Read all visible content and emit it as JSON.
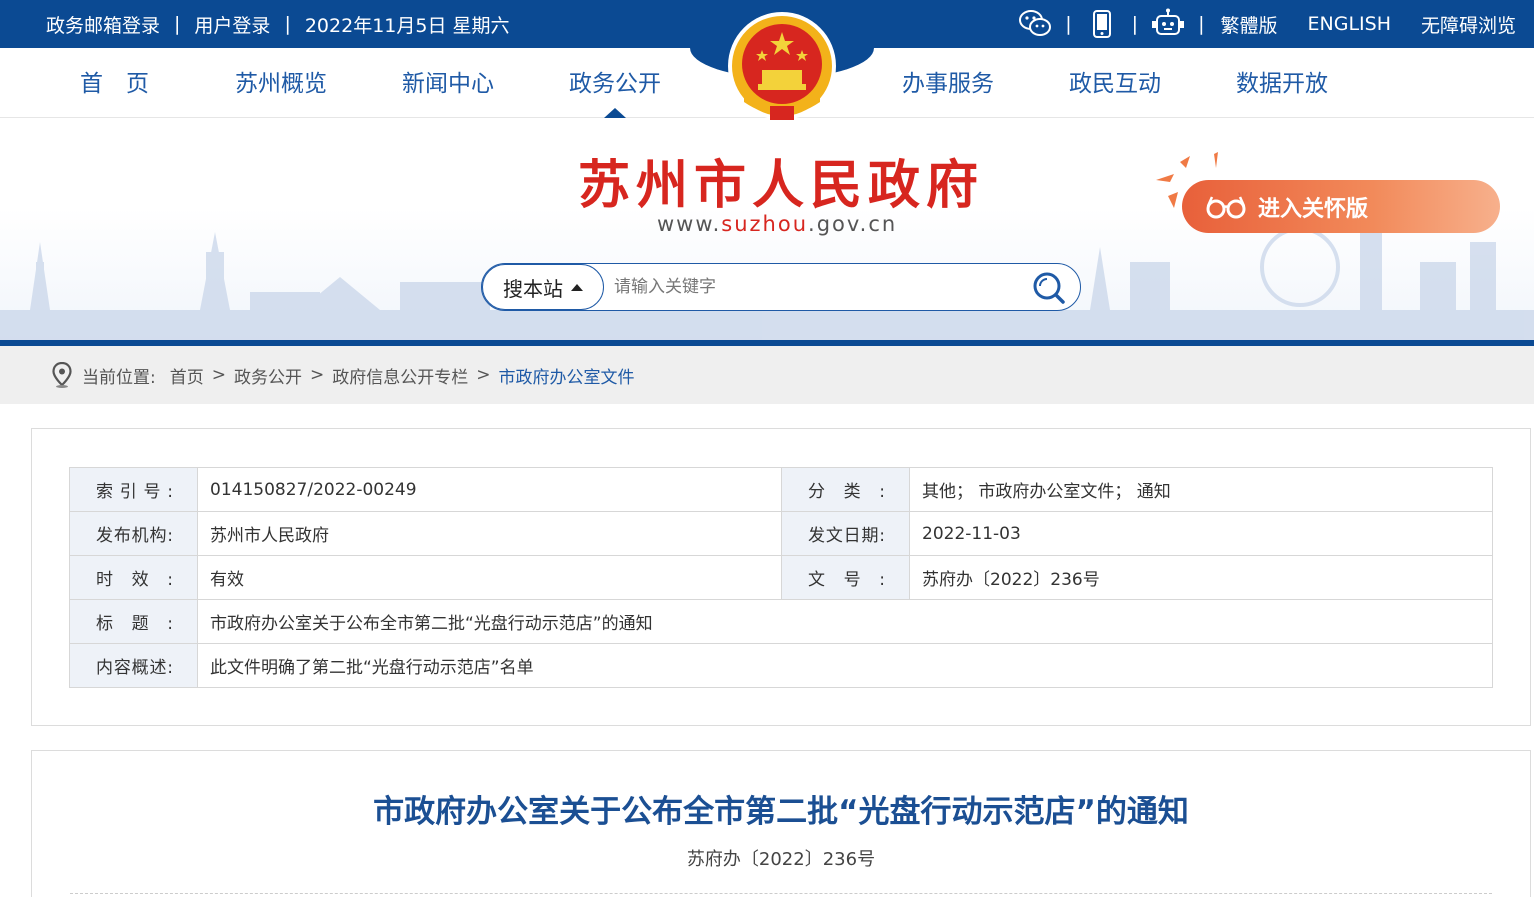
{
  "topbar": {
    "links_left": [
      "政务邮箱登录",
      "用户登录"
    ],
    "date": "2022年11月5日 星期六",
    "icons": [
      "wechat-icon",
      "mobile-icon",
      "robot-icon"
    ],
    "links_right": [
      "繁體版",
      "ENGLISH",
      "无障碍浏览"
    ],
    "separator": "|"
  },
  "nav": {
    "items": [
      "首　页",
      "苏州概览",
      "新闻中心",
      "政务公开",
      "办事服务",
      "政民互动",
      "数据开放"
    ],
    "active": "政务公开"
  },
  "header": {
    "site_title": "苏州市人民政府",
    "url_prefix": "www.",
    "url_highlight": "suzhou",
    "url_suffix": ".gov.cn",
    "care_label": "进入关怀版"
  },
  "search": {
    "scope": "搜本站",
    "placeholder": "请输入关键字"
  },
  "breadcrumb": {
    "label": "当前位置:",
    "items": [
      "首页",
      "政务公开",
      "政府信息公开专栏",
      "市政府办公室文件"
    ],
    "separator": ">"
  },
  "meta": {
    "index_key": "索引号:",
    "index_val": "014150827/2022-00249",
    "category_key": "分类:",
    "category_val": "其他；  市政府办公室文件；  通知",
    "issuer_key": "发布机构:",
    "issuer_val": "苏州市人民政府",
    "date_key": "发文日期:",
    "date_val": "2022-11-03",
    "validity_key": "时效:",
    "validity_val": "有效",
    "docno_key": "文号:",
    "docno_val": "苏府办〔2022〕236号",
    "title_key": "标题:",
    "title_val": "市政府办公室关于公布全市第二批“光盘行动示范店”的通知",
    "summary_key": "内容概述:",
    "summary_val": "此文件明确了第二批“光盘行动示范店”名单"
  },
  "document": {
    "title": "市政府办公室关于公布全市第二批“光盘行动示范店”的通知",
    "number": "苏府办〔2022〕236号"
  },
  "colors": {
    "brand_blue": "#0b4a93",
    "nav_blue": "#1f5aa6",
    "title_red": "#d7261f",
    "care_orange": "#e8603a"
  }
}
